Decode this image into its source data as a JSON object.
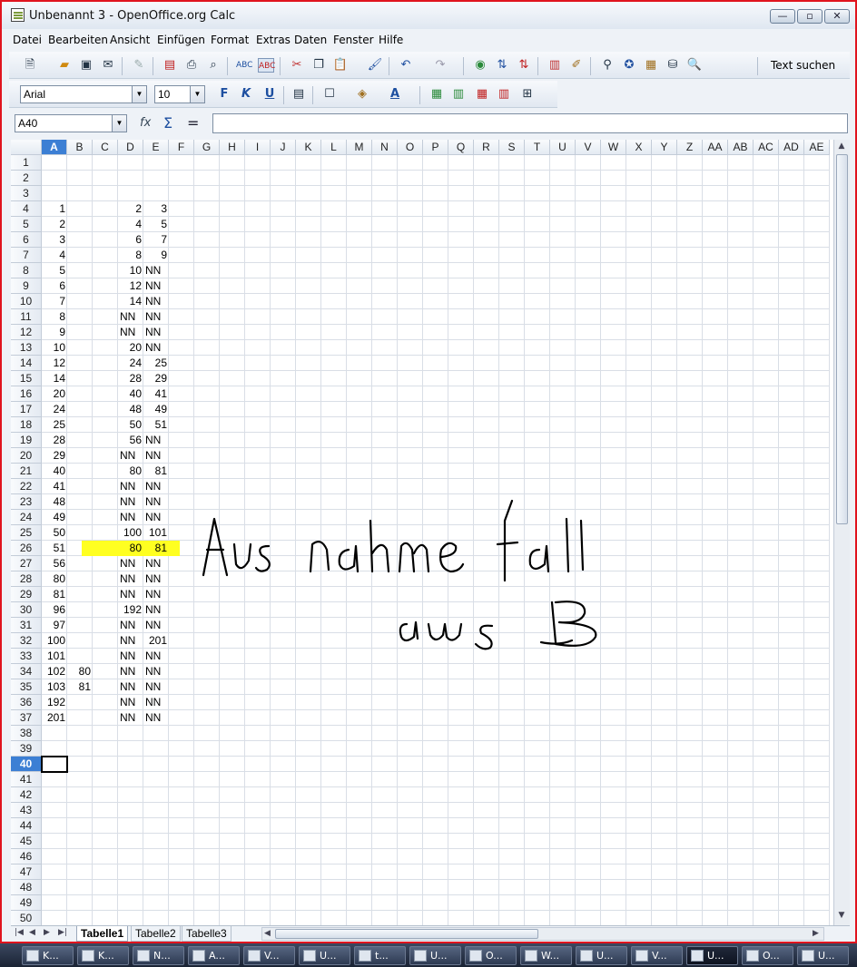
{
  "window": {
    "title": "Unbenannt 3 - OpenOffice.org Calc"
  },
  "menu": [
    "Datei",
    "Bearbeiten",
    "Ansicht",
    "Einfügen",
    "Format",
    "Extras",
    "Daten",
    "Fenster",
    "Hilfe"
  ],
  "toolbar": {
    "find_label": "Text suchen"
  },
  "format_bar": {
    "font": "Arial",
    "size": "10"
  },
  "formula_bar": {
    "name_box": "A40",
    "fx": "fx",
    "sum": "Σ",
    "equals": "=",
    "content": ""
  },
  "columns": [
    "A",
    "B",
    "C",
    "D",
    "E",
    "F",
    "G",
    "H",
    "I",
    "J",
    "K",
    "L",
    "M",
    "N",
    "O",
    "P",
    "Q",
    "R",
    "S",
    "T",
    "U",
    "V",
    "W",
    "X",
    "Y",
    "Z",
    "AA",
    "AB",
    "AC",
    "AD",
    "AE"
  ],
  "selected_cell": "A40",
  "highlighted_row": 26,
  "rows": [
    {
      "r": 1
    },
    {
      "r": 2
    },
    {
      "r": 3
    },
    {
      "r": 4,
      "A": "1",
      "D": "2",
      "E": "3"
    },
    {
      "r": 5,
      "A": "2",
      "D": "4",
      "E": "5"
    },
    {
      "r": 6,
      "A": "3",
      "D": "6",
      "E": "7"
    },
    {
      "r": 7,
      "A": "4",
      "D": "8",
      "E": "9"
    },
    {
      "r": 8,
      "A": "5",
      "D": "10",
      "E": "NN"
    },
    {
      "r": 9,
      "A": "6",
      "D": "12",
      "E": "NN"
    },
    {
      "r": 10,
      "A": "7",
      "D": "14",
      "E": "NN"
    },
    {
      "r": 11,
      "A": "8",
      "D": "NN",
      "E": "NN"
    },
    {
      "r": 12,
      "A": "9",
      "D": "NN",
      "E": "NN"
    },
    {
      "r": 13,
      "A": "10",
      "D": "20",
      "E": "NN"
    },
    {
      "r": 14,
      "A": "12",
      "D": "24",
      "E": "25"
    },
    {
      "r": 15,
      "A": "14",
      "D": "28",
      "E": "29"
    },
    {
      "r": 16,
      "A": "20",
      "D": "40",
      "E": "41"
    },
    {
      "r": 17,
      "A": "24",
      "D": "48",
      "E": "49"
    },
    {
      "r": 18,
      "A": "25",
      "D": "50",
      "E": "51"
    },
    {
      "r": 19,
      "A": "28",
      "D": "56",
      "E": "NN"
    },
    {
      "r": 20,
      "A": "29",
      "D": "NN",
      "E": "NN"
    },
    {
      "r": 21,
      "A": "40",
      "D": "80",
      "E": "81"
    },
    {
      "r": 22,
      "A": "41",
      "D": "NN",
      "E": "NN"
    },
    {
      "r": 23,
      "A": "48",
      "D": "NN",
      "E": "NN"
    },
    {
      "r": 24,
      "A": "49",
      "D": "NN",
      "E": "NN"
    },
    {
      "r": 25,
      "A": "50",
      "D": "100",
      "E": "101"
    },
    {
      "r": 26,
      "A": "51",
      "D": "80",
      "E": "81"
    },
    {
      "r": 27,
      "A": "56",
      "D": "NN",
      "E": "NN"
    },
    {
      "r": 28,
      "A": "80",
      "D": "NN",
      "E": "NN"
    },
    {
      "r": 29,
      "A": "81",
      "D": "NN",
      "E": "NN"
    },
    {
      "r": 30,
      "A": "96",
      "D": "192",
      "E": "NN"
    },
    {
      "r": 31,
      "A": "97",
      "D": "NN",
      "E": "NN"
    },
    {
      "r": 32,
      "A": "100",
      "D": "NN",
      "E": "201"
    },
    {
      "r": 33,
      "A": "101",
      "D": "NN",
      "E": "NN"
    },
    {
      "r": 34,
      "A": "102",
      "B": "80",
      "D": "NN",
      "E": "NN"
    },
    {
      "r": 35,
      "A": "103",
      "B": "81",
      "D": "NN",
      "E": "NN"
    },
    {
      "r": 36,
      "A": "192",
      "D": "NN",
      "E": "NN"
    },
    {
      "r": 37,
      "A": "201",
      "D": "NN",
      "E": "NN"
    },
    {
      "r": 38
    },
    {
      "r": 39
    },
    {
      "r": 40
    },
    {
      "r": 41
    },
    {
      "r": 42
    },
    {
      "r": 43
    },
    {
      "r": 44
    },
    {
      "r": 45
    },
    {
      "r": 46
    },
    {
      "r": 47
    },
    {
      "r": 48
    },
    {
      "r": 49
    },
    {
      "r": 50
    }
  ],
  "handwriting": {
    "line1": "Ausnahmefall",
    "line2": "aus B"
  },
  "sheet_tabs": [
    "Tabelle1",
    "Tabelle2",
    "Tabelle3"
  ],
  "active_tab": "Tabelle1",
  "taskbar": [
    "K...",
    "K...",
    "N...",
    "A...",
    "V...",
    "U...",
    "t...",
    "U...",
    "O...",
    "W...",
    "U...",
    "V...",
    "U...",
    "O...",
    "U..."
  ],
  "colors": {
    "highlight": "#ffff21",
    "selection": "#3c7fd4",
    "window_border": "#e0141e"
  }
}
